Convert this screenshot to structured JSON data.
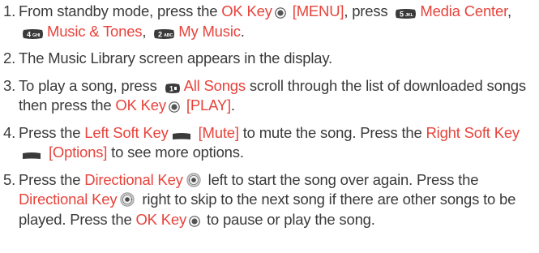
{
  "steps": [
    {
      "num": "1.",
      "t1": "From standby mode, press the ",
      "l1": "OK Key",
      "t2": " ",
      "l2": "[MENU]",
      "t3": ", press ",
      "l3": "Media Center",
      "t4": ", ",
      "l4": "Music & Tones",
      "t5": ", ",
      "l5": "My Music",
      "t6": "."
    },
    {
      "num": "2.",
      "text": "The Music Library screen appears in the display."
    },
    {
      "num": "3.",
      "t1": "To play a song, press ",
      "l1": "All Songs",
      "t2": " scroll through the list of downloaded songs then press the ",
      "l2": "OK Key",
      "t3": " ",
      "l3": "[PLAY]",
      "t4": "."
    },
    {
      "num": "4.",
      "t1": "Press the ",
      "l1": "Left Soft Key",
      "t2": " ",
      "l2": "[Mute]",
      "t3": " to mute the song. Press the ",
      "l3": "Right Soft Key",
      "t4": " ",
      "l4": "[Options]",
      "t5": " to see more options."
    },
    {
      "num": "5.",
      "t1": "Press the ",
      "l1": "Directional Key",
      "t2": " left to start the song over again. Press the ",
      "l2": "Directional Key",
      "t3": " right to skip to the next song if there are other songs to be played. Press the ",
      "l3": "OK Key",
      "t4": " to pause or play the song."
    }
  ],
  "icons": {
    "ok_key": "ok-key-icon",
    "key5": "5-jkl-key-icon",
    "key4": "4-ghi-key-icon",
    "key2": "2-abc-key-icon",
    "key1": "1-key-icon",
    "left_soft_key": "left-soft-key-icon",
    "right_soft_key": "right-soft-key-icon",
    "directional_key": "directional-key-icon"
  },
  "colors": {
    "text": "#3a3a3a",
    "highlight": "#e8433b",
    "key_fill": "#3a3a3a"
  }
}
